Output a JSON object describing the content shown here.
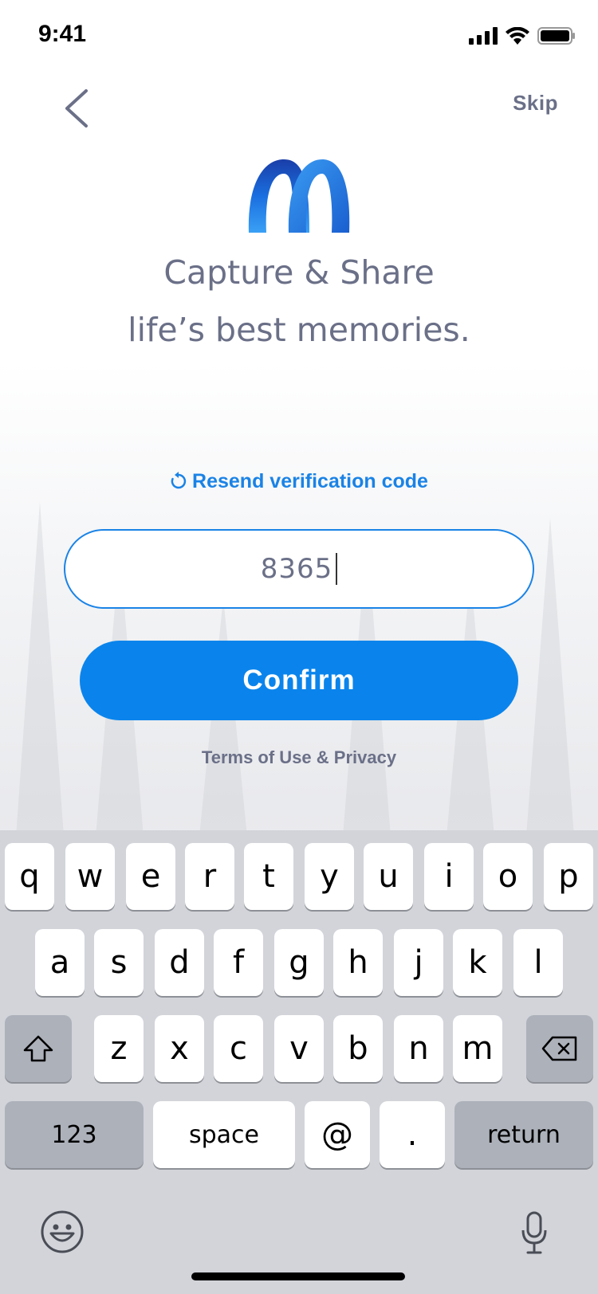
{
  "status_bar": {
    "time": "9:41"
  },
  "nav": {
    "skip_label": "Skip"
  },
  "headline": {
    "line1": "Capture & Share",
    "line2": "life’s best memories."
  },
  "verification": {
    "resend_label": "Resend verification code",
    "code_value": "8365"
  },
  "confirm_label": "Confirm",
  "terms_label": "Terms of Use & Privacy",
  "keyboard": {
    "row1": [
      "q",
      "w",
      "e",
      "r",
      "t",
      "y",
      "u",
      "i",
      "o",
      "p"
    ],
    "row2": [
      "a",
      "s",
      "d",
      "f",
      "g",
      "h",
      "j",
      "k",
      "l"
    ],
    "row3": [
      "z",
      "x",
      "c",
      "v",
      "b",
      "n",
      "m"
    ],
    "numbers_label": "123",
    "space_label": "space",
    "at_label": "@",
    "dot_label": ".",
    "return_label": "return"
  },
  "colors": {
    "accent": "#0a84ec",
    "text_muted": "#6b7088",
    "keyboard_bg": "#d2d4da",
    "special_key": "#acb1ba"
  },
  "icons": {
    "back": "chevron-left-icon",
    "logo": "app-logo",
    "resend": "refresh-icon",
    "shift": "shift-icon",
    "delete": "backspace-icon",
    "emoji": "emoji-icon",
    "mic": "microphone-icon"
  }
}
